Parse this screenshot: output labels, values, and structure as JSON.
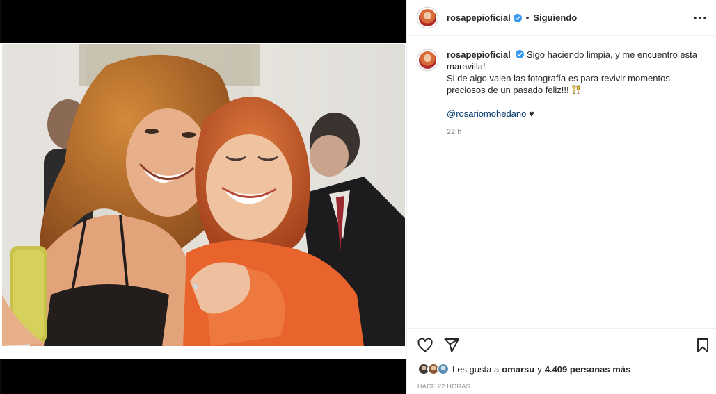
{
  "post": {
    "username": "rosapepioficial",
    "separator": "•",
    "follow_state": "Siguiendo",
    "more_icon": "more-horizontal-icon"
  },
  "caption": {
    "username": "rosapepioficial",
    "line1": "Sigo haciendo limpia, y me encuentro esta maravilla!",
    "line2": "Si de algo valen las fotografía es para revivir momentos preciosos de un pasado feliz!!!",
    "mention": "@rosariomohedano",
    "heart": "♥",
    "time": "22 h"
  },
  "actions": {
    "like_icon": "heart-outline-icon",
    "share_icon": "paper-plane-icon",
    "save_icon": "bookmark-icon"
  },
  "likes": {
    "prefix": "Les gusta a",
    "user": "omarsu",
    "connector": "y",
    "count_text": "4.409 personas más"
  },
  "posted_ago": "HACE 22 HORAS",
  "colors": {
    "verified": "#3897f0",
    "mention": "#00376b",
    "muted": "#8e8e8e",
    "border": "#efefef"
  }
}
